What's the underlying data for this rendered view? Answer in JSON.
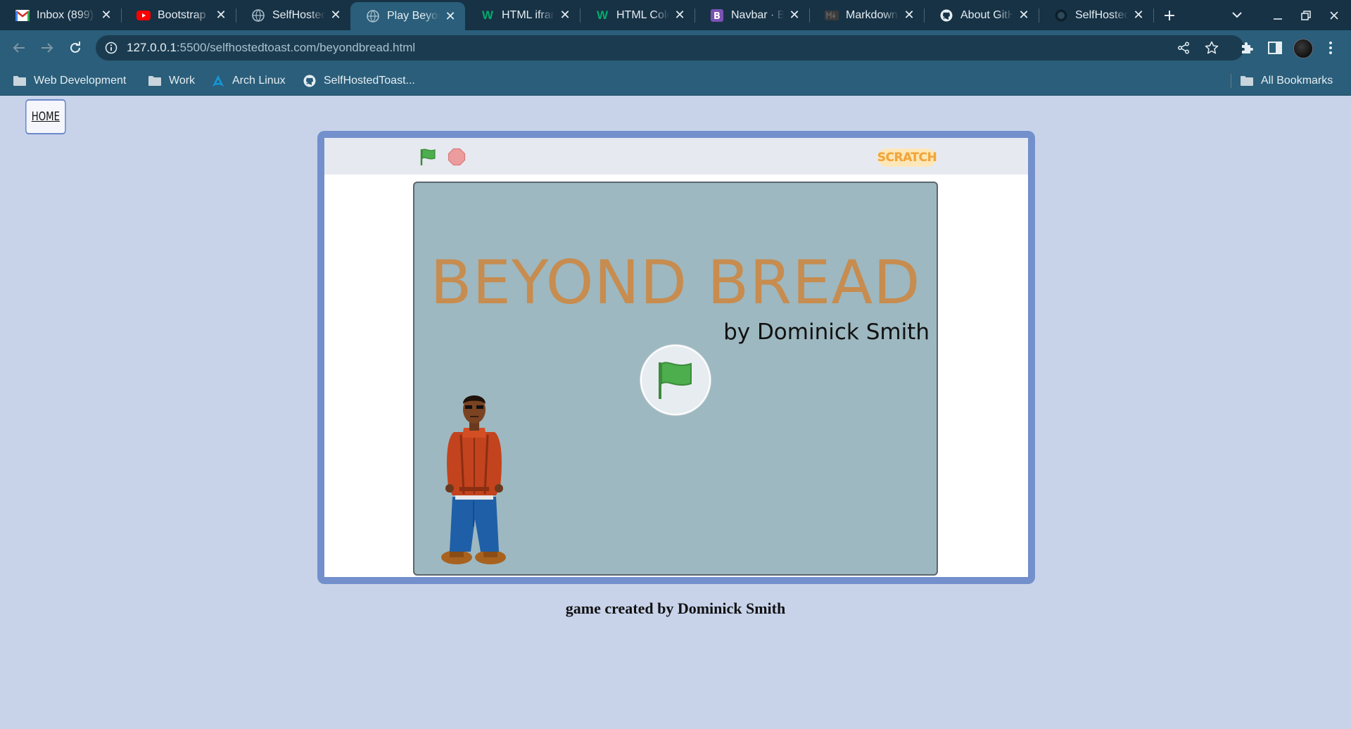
{
  "browser": {
    "tabs": [
      {
        "title": "Inbox (899)",
        "icon": "gmail-icon",
        "active": false
      },
      {
        "title": "Bootstrap",
        "icon": "youtube-icon",
        "active": false
      },
      {
        "title": "SelfHosted",
        "icon": "globe-icon",
        "active": false
      },
      {
        "title": "Play Beyond Bread",
        "icon": "globe-icon",
        "active": true
      },
      {
        "title": "HTML iframe",
        "icon": "w3schools-icon",
        "active": false
      },
      {
        "title": "HTML Colors",
        "icon": "w3schools-icon",
        "active": false
      },
      {
        "title": "Navbar · Bootstrap",
        "icon": "bootstrap-icon",
        "active": false
      },
      {
        "title": "Markdown",
        "icon": "markdown-icon",
        "active": false
      },
      {
        "title": "About GitHub",
        "icon": "github-icon",
        "active": false
      },
      {
        "title": "SelfHosted",
        "icon": "github-icon",
        "active": false
      }
    ],
    "url": {
      "host": "127.0.0.1",
      "rest": ":5500/selfhostedtoast.com/beyondbread.html"
    },
    "bookmarks": [
      {
        "label": "Web Development",
        "icon": "folder-icon"
      },
      {
        "label": "Work",
        "icon": "folder-icon"
      },
      {
        "label": "Arch Linux",
        "icon": "arch-linux-icon"
      },
      {
        "label": "SelfHostedToast...",
        "icon": "github-icon"
      }
    ],
    "all_bookmarks": "All Bookmarks"
  },
  "page": {
    "home_label": "HOME",
    "player": {
      "scratch_logo": "SCRATCH",
      "game_title": "BEYOND BREAD",
      "game_byline": "by Dominick Smith"
    },
    "caption": "game created by Dominick Smith"
  },
  "colors": {
    "page_bg": "#c8d3ea",
    "frame_border": "#7390cc",
    "stage_bg": "#9db8c0",
    "title_color": "#c78c4f",
    "flag_green": "#4cae4c",
    "stop_red": "#ec9c9c"
  }
}
